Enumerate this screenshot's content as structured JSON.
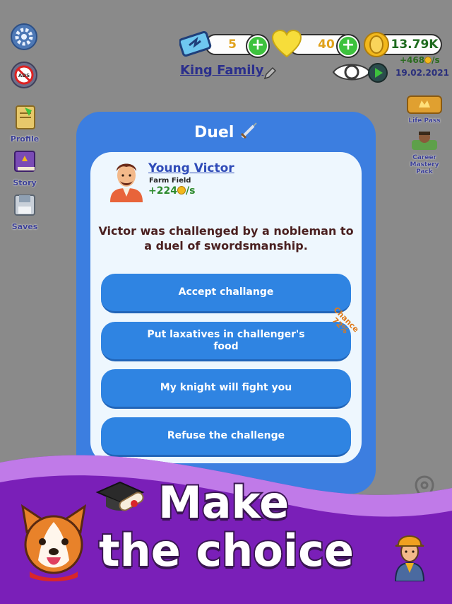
{
  "topbar": {
    "tickets": "5",
    "hearts": "40",
    "coins": "13.79K",
    "income": "+468",
    "income_unit": "/s",
    "date": "19.02.2021",
    "family_name": "King Family"
  },
  "sidebar": {
    "items": [
      {
        "label": "Profile"
      },
      {
        "label": "Story"
      },
      {
        "label": "Saves"
      }
    ],
    "life_pass": "Life Pass",
    "career_pack": "Career Mastery Pack"
  },
  "dialog": {
    "title": "Duel",
    "character": {
      "name": "Young Victor",
      "job": "Farm Field",
      "income": "+224",
      "income_unit": "/s"
    },
    "story": "Victor was challenged by a nobleman to a duel of swordsmanship.",
    "choices": [
      {
        "label": "Accept challange"
      },
      {
        "label": "Put laxatives in challenger's food"
      },
      {
        "label": "My knight will fight you"
      },
      {
        "label": "Refuse the challenge"
      }
    ],
    "chance_label": "Chance",
    "chance_value": "72%"
  },
  "promo": {
    "line1": "Make",
    "line2": "the choice"
  },
  "colors": {
    "dialog_blue": "#3c7ee0",
    "button_blue": "#2f84e2",
    "banner_purple": "#7a1fb8",
    "coin_gold": "#f2b81c",
    "plus_green": "#3dc23d"
  }
}
